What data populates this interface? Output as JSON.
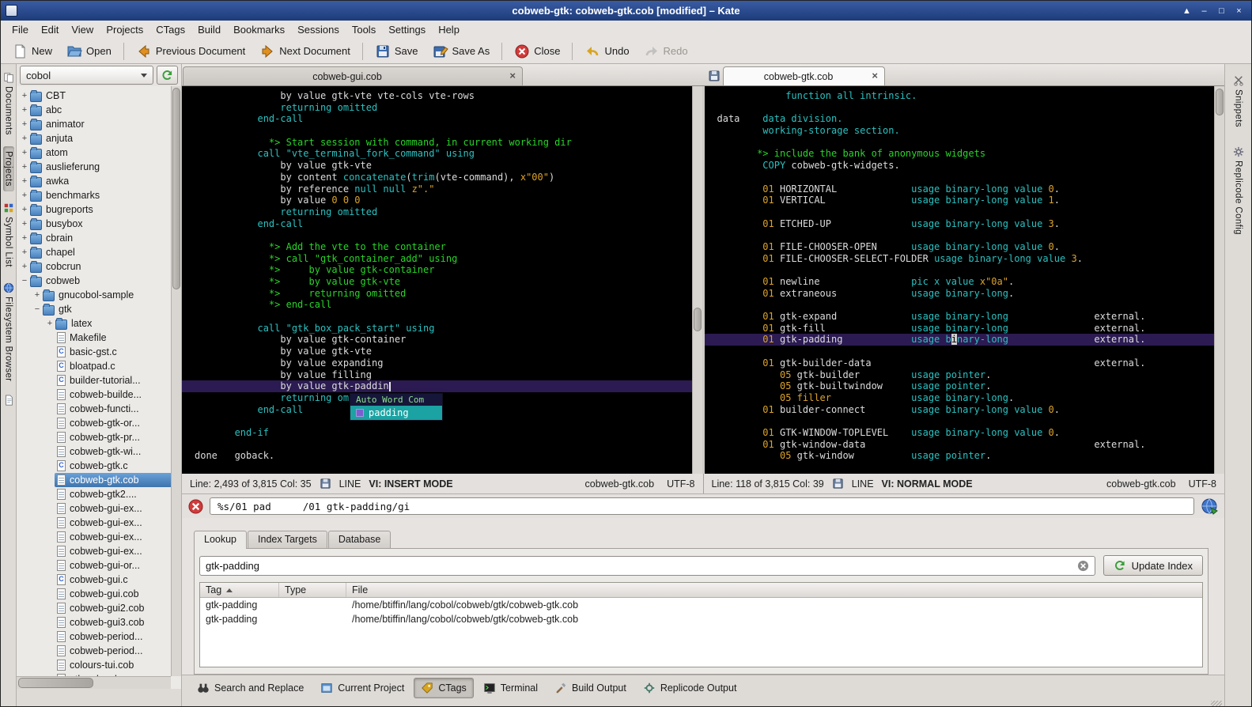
{
  "window": {
    "title": "cobweb-gtk: cobweb-gtk.cob [modified] – Kate",
    "controls": [
      "▲",
      "–",
      "□",
      "×"
    ]
  },
  "menubar": [
    "File",
    "Edit",
    "View",
    "Projects",
    "CTags",
    "Build",
    "Bookmarks",
    "Sessions",
    "Tools",
    "Settings",
    "Help"
  ],
  "toolbar": [
    {
      "label": "New",
      "icon": "new"
    },
    {
      "label": "Open",
      "icon": "open"
    },
    {
      "sep": true
    },
    {
      "label": "Previous Document",
      "icon": "prev"
    },
    {
      "label": "Next Document",
      "icon": "next"
    },
    {
      "sep": true
    },
    {
      "label": "Save",
      "icon": "save"
    },
    {
      "label": "Save As",
      "icon": "saveas"
    },
    {
      "sep": true
    },
    {
      "label": "Close",
      "icon": "close"
    },
    {
      "sep": true
    },
    {
      "label": "Undo",
      "icon": "undo"
    },
    {
      "label": "Redo",
      "icon": "redo",
      "disabled": true
    }
  ],
  "left_strip": [
    {
      "label": "Documents",
      "icon": "documents"
    },
    {
      "label": "Projects",
      "active": true
    },
    {
      "label": "Symbol List",
      "icon": "symbols"
    },
    {
      "label": "Filesystem Browser",
      "icon": "smallglobe"
    },
    {
      "label": "",
      "icon": "doc"
    }
  ],
  "right_strip": [
    {
      "label": "Snippets",
      "icon": "snippets"
    },
    {
      "label": "Replicode Config",
      "icon": "gear"
    }
  ],
  "project_panel": {
    "selector": "cobol",
    "tree": [
      {
        "label": "CBT",
        "depth": 0,
        "icon": "folder",
        "exp": "+"
      },
      {
        "label": "abc",
        "depth": 0,
        "icon": "folder",
        "exp": "+"
      },
      {
        "label": "animator",
        "depth": 0,
        "icon": "folder",
        "exp": "+"
      },
      {
        "label": "anjuta",
        "depth": 0,
        "icon": "folder",
        "exp": "+"
      },
      {
        "label": "atom",
        "depth": 0,
        "icon": "folder",
        "exp": "+"
      },
      {
        "label": "auslieferung",
        "depth": 0,
        "icon": "folder",
        "exp": "+"
      },
      {
        "label": "awka",
        "depth": 0,
        "icon": "folder",
        "exp": "+"
      },
      {
        "label": "benchmarks",
        "depth": 0,
        "icon": "folder",
        "exp": "+"
      },
      {
        "label": "bugreports",
        "depth": 0,
        "icon": "folder",
        "exp": "+"
      },
      {
        "label": "busybox",
        "depth": 0,
        "icon": "folder",
        "exp": "+"
      },
      {
        "label": "cbrain",
        "depth": 0,
        "icon": "folder",
        "exp": "+"
      },
      {
        "label": "chapel",
        "depth": 0,
        "icon": "folder",
        "exp": "+"
      },
      {
        "label": "cobcrun",
        "depth": 0,
        "icon": "folder",
        "exp": "+"
      },
      {
        "label": "cobweb",
        "depth": 0,
        "icon": "folder",
        "exp": "−"
      },
      {
        "label": "gnucobol-sample",
        "depth": 1,
        "icon": "folder",
        "exp": "+"
      },
      {
        "label": "gtk",
        "depth": 1,
        "icon": "folder",
        "exp": "−"
      },
      {
        "label": "latex",
        "depth": 2,
        "icon": "folder",
        "exp": "+"
      },
      {
        "label": "Makefile",
        "depth": 2,
        "icon": "file"
      },
      {
        "label": "basic-gst.c",
        "depth": 2,
        "icon": "cfile"
      },
      {
        "label": "bloatpad.c",
        "depth": 2,
        "icon": "cfile"
      },
      {
        "label": "builder-tutorial...",
        "depth": 2,
        "icon": "cfile"
      },
      {
        "label": "cobweb-builde...",
        "depth": 2,
        "icon": "file"
      },
      {
        "label": "cobweb-functi...",
        "depth": 2,
        "icon": "file"
      },
      {
        "label": "cobweb-gtk-or...",
        "depth": 2,
        "icon": "file"
      },
      {
        "label": "cobweb-gtk-pr...",
        "depth": 2,
        "icon": "file"
      },
      {
        "label": "cobweb-gtk-wi...",
        "depth": 2,
        "icon": "file"
      },
      {
        "label": "cobweb-gtk.c",
        "depth": 2,
        "icon": "cfile"
      },
      {
        "label": "cobweb-gtk.cob",
        "depth": 2,
        "icon": "file",
        "selected": true
      },
      {
        "label": "cobweb-gtk2....",
        "depth": 2,
        "icon": "file"
      },
      {
        "label": "cobweb-gui-ex...",
        "depth": 2,
        "icon": "file"
      },
      {
        "label": "cobweb-gui-ex...",
        "depth": 2,
        "icon": "file"
      },
      {
        "label": "cobweb-gui-ex...",
        "depth": 2,
        "icon": "file"
      },
      {
        "label": "cobweb-gui-ex...",
        "depth": 2,
        "icon": "file"
      },
      {
        "label": "cobweb-gui-or...",
        "depth": 2,
        "icon": "file"
      },
      {
        "label": "cobweb-gui.c",
        "depth": 2,
        "icon": "cfile"
      },
      {
        "label": "cobweb-gui.cob",
        "depth": 2,
        "icon": "file"
      },
      {
        "label": "cobweb-gui2.cob",
        "depth": 2,
        "icon": "file"
      },
      {
        "label": "cobweb-gui3.cob",
        "depth": 2,
        "icon": "file"
      },
      {
        "label": "cobweb-period...",
        "depth": 2,
        "icon": "file"
      },
      {
        "label": "cobweb-period...",
        "depth": 2,
        "icon": "file"
      },
      {
        "label": "colours-tui.cob",
        "depth": 2,
        "icon": "file"
      },
      {
        "label": "gtk-cobweb-g...",
        "depth": 2,
        "icon": "file"
      }
    ]
  },
  "editors": {
    "left": {
      "tab": "cobweb-gui.cob",
      "hl_line": 26,
      "status": {
        "line": "Line: 2,493 of 3,815 Col: 35",
        "mode": "LINE",
        "vi": "VI: INSERT MODE",
        "file": "cobweb-gtk.cob",
        "encoding": "UTF-8"
      },
      "lines": [
        [
          [
            "p",
            "               by value gtk-vte vte-cols vte-rows"
          ]
        ],
        [
          [
            "k",
            "               returning omitted"
          ]
        ],
        [
          [
            "k",
            "           end-call"
          ]
        ],
        [],
        [
          [
            "c",
            "             *> Start session with command, in current working dir"
          ]
        ],
        [
          [
            "k",
            "           call \"vte_terminal_fork_command\" using"
          ]
        ],
        [
          [
            "p",
            "               by value gtk-vte"
          ]
        ],
        [
          [
            "p",
            "               by content "
          ],
          [
            "k",
            "concatenate"
          ],
          [
            "p",
            "("
          ],
          [
            "k",
            "trim"
          ],
          [
            "p",
            "(vte-command), "
          ],
          [
            "o",
            "x\"00\""
          ],
          [
            "p",
            ")"
          ]
        ],
        [
          [
            "p",
            "               by reference "
          ],
          [
            "k",
            "null null"
          ],
          [
            "p",
            " "
          ],
          [
            "o",
            "z\".\""
          ]
        ],
        [
          [
            "p",
            "               by value "
          ],
          [
            "o",
            "0 0 0"
          ]
        ],
        [
          [
            "k",
            "               returning omitted"
          ]
        ],
        [
          [
            "k",
            "           end-call"
          ]
        ],
        [],
        [
          [
            "c",
            "             *> Add the vte to the container"
          ]
        ],
        [
          [
            "c",
            "             *> call \"gtk_container_add\" using"
          ]
        ],
        [
          [
            "c",
            "             *>     by value gtk-container"
          ]
        ],
        [
          [
            "c",
            "             *>     by value gtk-vte"
          ]
        ],
        [
          [
            "c",
            "             *>     returning omitted"
          ]
        ],
        [
          [
            "c",
            "             *> end-call"
          ]
        ],
        [],
        [
          [
            "k",
            "           call \"gtk_box_pack_start\" using"
          ]
        ],
        [
          [
            "p",
            "               by value gtk-container"
          ]
        ],
        [
          [
            "p",
            "               by value gtk-vte"
          ]
        ],
        [
          [
            "p",
            "               by value expanding"
          ]
        ],
        [
          [
            "p",
            "               by value filling"
          ]
        ],
        [
          [
            "p",
            "               by value gtk-paddin"
          ],
          [
            "caret",
            " "
          ]
        ],
        [
          [
            "k",
            "               returning omitted"
          ]
        ],
        [
          [
            "k",
            "           end-call"
          ]
        ],
        [],
        [
          [
            "k",
            "       end-if"
          ]
        ],
        [],
        [
          [
            "p",
            "done   goback."
          ]
        ]
      ]
    },
    "right": {
      "tab": "cobweb-gtk.cob",
      "modified": true,
      "hl_line": 22,
      "status": {
        "line": "Line: 118 of 3,815 Col: 39",
        "mode": "LINE",
        "vi": "VI: NORMAL MODE",
        "file": "cobweb-gtk.cob",
        "encoding": "UTF-8"
      },
      "lines": [
        [
          [
            "k",
            "            function all intrinsic."
          ]
        ],
        [],
        [
          [
            "p",
            "data    "
          ],
          [
            "k",
            "data division."
          ]
        ],
        [
          [
            "k",
            "        working-storage section."
          ]
        ],
        [],
        [
          [
            "c",
            "       *> include the bank of anonymous widgets"
          ]
        ],
        [
          [
            "k",
            "        COPY "
          ],
          [
            "p",
            "cobweb-gtk-widgets."
          ]
        ],
        [],
        [
          [
            "o",
            "        01 "
          ],
          [
            "p",
            "HORIZONTAL             "
          ],
          [
            "k",
            "usage binary-long value "
          ],
          [
            "o",
            "0"
          ],
          [
            "p",
            "."
          ]
        ],
        [
          [
            "o",
            "        01 "
          ],
          [
            "p",
            "VERTICAL               "
          ],
          [
            "k",
            "usage binary-long value "
          ],
          [
            "o",
            "1"
          ],
          [
            "p",
            "."
          ]
        ],
        [],
        [
          [
            "o",
            "        01 "
          ],
          [
            "p",
            "ETCHED-UP              "
          ],
          [
            "k",
            "usage binary-long value "
          ],
          [
            "o",
            "3"
          ],
          [
            "p",
            "."
          ]
        ],
        [],
        [
          [
            "o",
            "        01 "
          ],
          [
            "p",
            "FILE-CHOOSER-OPEN      "
          ],
          [
            "k",
            "usage binary-long value "
          ],
          [
            "o",
            "0"
          ],
          [
            "p",
            "."
          ]
        ],
        [
          [
            "o",
            "        01 "
          ],
          [
            "p",
            "FILE-CHOOSER-SELECT-FOLDER "
          ],
          [
            "k",
            "usage binary-long value "
          ],
          [
            "o",
            "3"
          ],
          [
            "p",
            "."
          ]
        ],
        [],
        [
          [
            "o",
            "        01 "
          ],
          [
            "p",
            "newline                "
          ],
          [
            "k",
            "pic x value "
          ],
          [
            "o",
            "x\"0a\""
          ],
          [
            "p",
            "."
          ]
        ],
        [
          [
            "o",
            "        01 "
          ],
          [
            "p",
            "extraneous             "
          ],
          [
            "k",
            "usage binary-long"
          ],
          [
            "p",
            "."
          ]
        ],
        [],
        [
          [
            "o",
            "        01 "
          ],
          [
            "p",
            "gtk-expand             "
          ],
          [
            "k",
            "usage binary-long"
          ],
          [
            "p",
            "               external."
          ]
        ],
        [
          [
            "o",
            "        01 "
          ],
          [
            "p",
            "gtk-fill               "
          ],
          [
            "k",
            "usage binary-long"
          ],
          [
            "p",
            "               external."
          ]
        ],
        [
          [
            "o",
            "        01 "
          ],
          [
            "p",
            "gtk-padding            "
          ],
          [
            "k",
            "usage b"
          ],
          [
            "cur",
            "i"
          ],
          [
            "k",
            "nary-long"
          ],
          [
            "p",
            "               external."
          ]
        ],
        [],
        [
          [
            "o",
            "        01 "
          ],
          [
            "p",
            "gtk-builder-data                                       external."
          ]
        ],
        [
          [
            "o",
            "           05 "
          ],
          [
            "p",
            "gtk-builder         "
          ],
          [
            "k",
            "usage pointer"
          ],
          [
            "p",
            "."
          ]
        ],
        [
          [
            "o",
            "           05 "
          ],
          [
            "p",
            "gtk-builtwindow     "
          ],
          [
            "k",
            "usage pointer"
          ],
          [
            "p",
            "."
          ]
        ],
        [
          [
            "o",
            "           05 "
          ],
          [
            "o",
            "filler"
          ],
          [
            "p",
            "              "
          ],
          [
            "k",
            "usage binary-long"
          ],
          [
            "p",
            "."
          ]
        ],
        [
          [
            "o",
            "        01 "
          ],
          [
            "p",
            "builder-connect        "
          ],
          [
            "k",
            "usage binary-long value "
          ],
          [
            "o",
            "0"
          ],
          [
            "p",
            "."
          ]
        ],
        [],
        [
          [
            "o",
            "        01 "
          ],
          [
            "p",
            "GTK-WINDOW-TOPLEVEL    "
          ],
          [
            "k",
            "usage binary-long value "
          ],
          [
            "o",
            "0"
          ],
          [
            "p",
            "."
          ]
        ],
        [
          [
            "o",
            "        01 "
          ],
          [
            "p",
            "gtk-window-data                                        external."
          ]
        ],
        [
          [
            "o",
            "           05 "
          ],
          [
            "p",
            "gtk-window          "
          ],
          [
            "k",
            "usage pointer"
          ],
          [
            "p",
            "."
          ]
        ]
      ]
    }
  },
  "completion": {
    "title": "Auto Word Com",
    "selected": "padding"
  },
  "command_bar": {
    "cmd": "%s/01 pad",
    "hint": "/01 gtk-padding/gi"
  },
  "ctags": {
    "tabs": [
      "Lookup",
      "Index Targets",
      "Database"
    ],
    "active_tab": "Lookup",
    "search_value": "gtk-padding",
    "update_button": "Update Index",
    "columns": [
      "Tag",
      "Type",
      "File"
    ],
    "rows": [
      {
        "tag": "gtk-padding",
        "type": "",
        "file": "/home/btiffin/lang/cobol/cobweb/gtk/cobweb-gtk.cob"
      },
      {
        "tag": "gtk-padding",
        "type": "",
        "file": "/home/btiffin/lang/cobol/cobweb/gtk/cobweb-gtk.cob"
      }
    ]
  },
  "bottom_bar": [
    {
      "label": "Search and Replace",
      "icon": "binoculars"
    },
    {
      "label": "Current Project",
      "icon": "project"
    },
    {
      "label": "CTags",
      "icon": "ctagsi",
      "active": true
    },
    {
      "label": "Terminal",
      "icon": "terminal"
    },
    {
      "label": "Build Output",
      "icon": "build"
    },
    {
      "label": "Replicode Output",
      "icon": "replicode"
    }
  ],
  "colors": {
    "titlebar": "#1c3b7a",
    "selection": "#3f74ad",
    "editor_bg": "#000000",
    "current_line": "#2b1b52",
    "keyword": "#2cc0c0",
    "comment": "#28d428",
    "literal": "#dca32a"
  }
}
